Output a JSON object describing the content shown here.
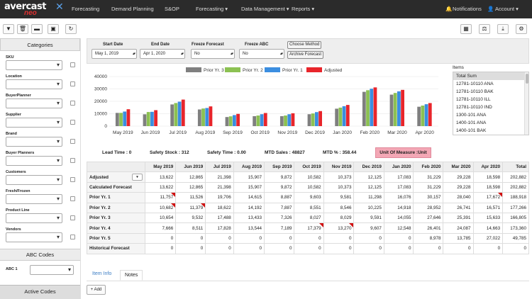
{
  "brand": {
    "name": "avercast",
    "suffix": "neo"
  },
  "nav": {
    "items": [
      "Forecasting",
      "Demand Planning",
      "S&OP",
      "Forecasting ▾",
      "Data Management ▾",
      "Reports ▾"
    ],
    "notifications": "Notifications",
    "account": "Account ▾"
  },
  "toolbar_icons": [
    "filter-icon",
    "trash-icon",
    "folder-icon",
    "save-icon",
    "refresh-icon"
  ],
  "toolbar_right_icons": [
    "calculator-icon",
    "scale-icon",
    "download-icon",
    "gear-icon"
  ],
  "sidebar": {
    "title": "Categories",
    "categories": [
      "SKU",
      "Location",
      "BuyerPlanner",
      "Supplier",
      "Brand",
      "Buyer Planners",
      "Customers",
      "Fresh/Frozen",
      "Product Line",
      "Vendors"
    ],
    "abc_title": "ABC Codes",
    "abc_label": "ABC 1",
    "active_codes": "Active Codes"
  },
  "filters": {
    "start_date_label": "Start Date",
    "start_date": "May 1, 2019",
    "end_date_label": "End Date",
    "end_date": "Apr 1, 2020",
    "freeze_forecast_label": "Freeze Forecast",
    "freeze_forecast": "No",
    "freeze_abc_label": "Freeze ABC",
    "freeze_abc": "No",
    "choose_method": "Choose Method",
    "archive_forecast": "Archive Forecast"
  },
  "items_panel": {
    "title": "Items",
    "list": [
      "Total Sum",
      "12781-10110 ANA",
      "12781-10110 BAK",
      "12781-10110 ILL",
      "12781-10110 IND",
      "1300-101 ANA",
      "1400-101 ANA",
      "1400-101 BAK"
    ]
  },
  "stats": {
    "lead_time": "Lead Time : 0",
    "safety_stock": "Safety Stock : 312",
    "safety_time": "Safety Time : 0.00",
    "mtd_sales": "MTD Sales : 48827",
    "mtd_pct": "MTD % : 358.44",
    "uom": "Unit Of Measure :Unit"
  },
  "colors": {
    "prior3": "#7f7f7f",
    "prior2": "#8cc152",
    "prior1": "#3b8ee0",
    "adjusted": "#e8252b"
  },
  "chart_data": {
    "type": "bar",
    "categories": [
      "May 2019",
      "Jun 2019",
      "Jul 2019",
      "Aug 2019",
      "Sep 2019",
      "Oct 2019",
      "Nov 2019",
      "Dec 2019",
      "Jan 2020",
      "Feb 2020",
      "Mar 2020",
      "Apr 2020"
    ],
    "series": [
      {
        "name": "Prior Yr. 3",
        "values": [
          10654,
          9532,
          17488,
          13433,
          7326,
          8027,
          8029,
          9591,
          14055,
          27646,
          25391,
          15633
        ]
      },
      {
        "name": "Prior Yr. 2",
        "values": [
          10682,
          11379,
          18622,
          14192,
          7887,
          8551,
          8546,
          10225,
          14918,
          28952,
          26741,
          16571
        ]
      },
      {
        "name": "Prior Yr. 1",
        "values": [
          11757,
          11526,
          19706,
          14615,
          8887,
          9603,
          9581,
          11298,
          16076,
          30157,
          28040,
          17672
        ]
      },
      {
        "name": "Adjusted",
        "values": [
          13622,
          12865,
          21398,
          15907,
          9872,
          10582,
          10373,
          12125,
          17083,
          31229,
          29228,
          18598
        ]
      }
    ],
    "ylim": [
      0,
      40000
    ],
    "yticks": [
      "0",
      "10000",
      "20000",
      "30000",
      "40000"
    ],
    "legend": "top",
    "grid": true
  },
  "table": {
    "headers": [
      "",
      "May 2019",
      "Jun 2019",
      "Jul 2019",
      "Aug 2019",
      "Sep 2019",
      "Oct 2019",
      "Nov 2019",
      "Dec 2019",
      "Jan 2020",
      "Feb 2020",
      "Mar 2020",
      "Apr 2020",
      "Total"
    ],
    "rows": [
      {
        "label": "Adjusted",
        "cells": [
          "13,622",
          "12,865",
          "21,398",
          "15,907",
          "9,872",
          "10,582",
          "10,373",
          "12,125",
          "17,083",
          "31,229",
          "29,228",
          "18,598",
          "202,882"
        ]
      },
      {
        "label": "Calculated Forecast",
        "cells": [
          "13,622",
          "12,865",
          "21,398",
          "15,907",
          "9,872",
          "10,582",
          "10,373",
          "12,125",
          "17,083",
          "31,229",
          "29,228",
          "18,598",
          "202,882"
        ]
      },
      {
        "label": "Prior Yr. 1",
        "cells": [
          "11,757",
          "11,526",
          "19,706",
          "14,615",
          "8,887",
          "9,603",
          "9,581",
          "11,298",
          "16,076",
          "30,157",
          "28,040",
          "17,672",
          "188,918"
        ]
      },
      {
        "label": "Prior Yr. 2",
        "cells": [
          "10,682",
          "11,379",
          "18,622",
          "14,192",
          "7,887",
          "8,551",
          "8,546",
          "10,225",
          "14,918",
          "28,952",
          "26,741",
          "16,571",
          "177,266"
        ]
      },
      {
        "label": "Prior Yr. 3",
        "cells": [
          "10,654",
          "9,532",
          "17,488",
          "13,433",
          "7,326",
          "8,027",
          "8,029",
          "9,591",
          "14,055",
          "27,646",
          "25,391",
          "15,633",
          "166,805"
        ]
      },
      {
        "label": "Prior Yr. 4",
        "cells": [
          "7,666",
          "8,511",
          "17,828",
          "13,544",
          "7,189",
          "17,379",
          "13,270",
          "9,607",
          "12,548",
          "26,401",
          "24,087",
          "14,663",
          "173,360"
        ]
      },
      {
        "label": "Prior Yr. 5",
        "cells": [
          "0",
          "0",
          "0",
          "0",
          "0",
          "0",
          "0",
          "0",
          "0",
          "8,978",
          "13,785",
          "27,022",
          "49,785"
        ]
      },
      {
        "label": "Historical Forecast",
        "cells": [
          "0",
          "0",
          "0",
          "0",
          "0",
          "0",
          "0",
          "0",
          "0",
          "0",
          "0",
          "0",
          "0"
        ]
      }
    ]
  },
  "tabs": [
    "Item Info",
    "Notes"
  ],
  "add_button": "+ Add"
}
